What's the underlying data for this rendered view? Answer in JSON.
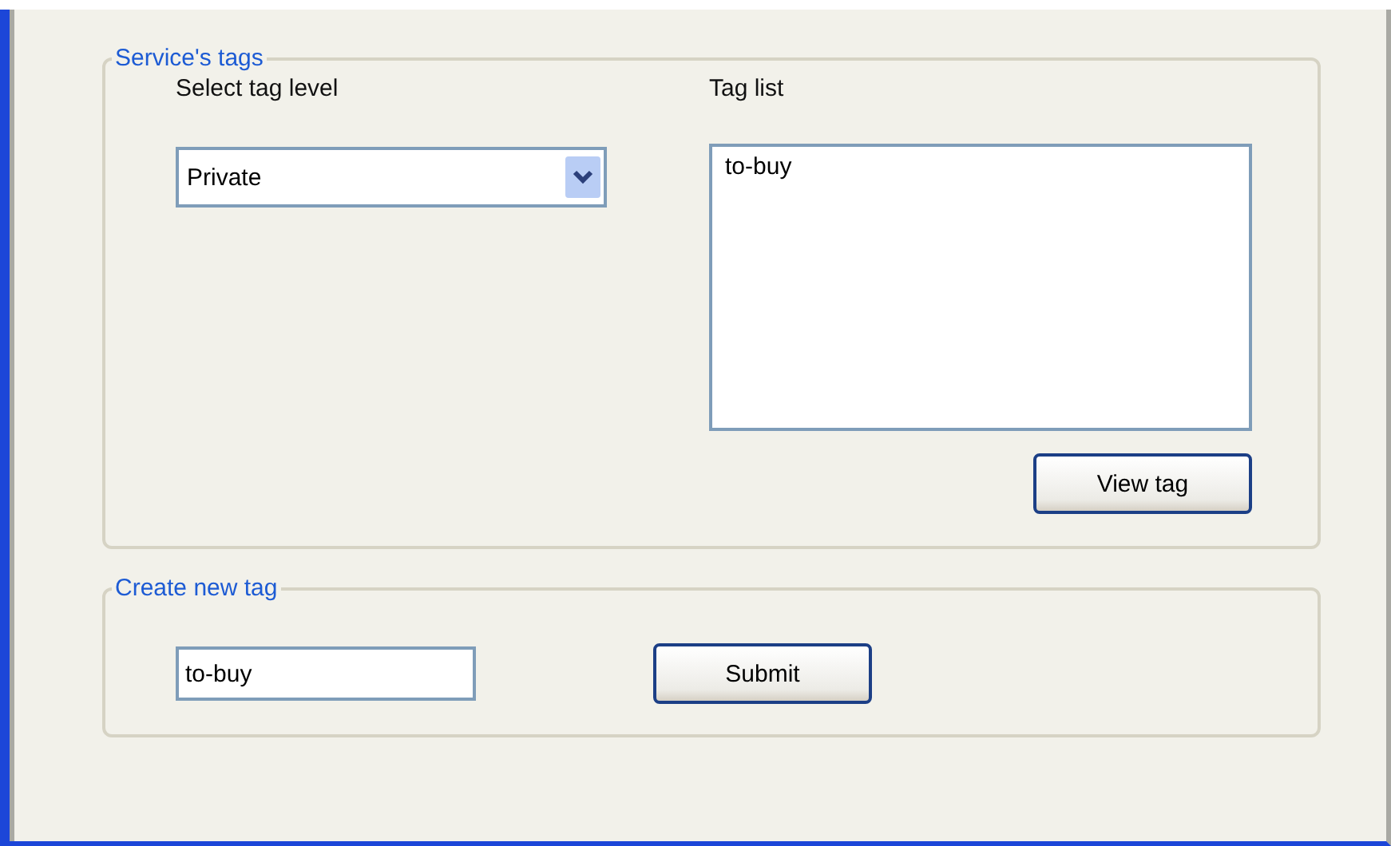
{
  "service_tags": {
    "title": "Service's tags",
    "level_label": "Select tag level",
    "level_select": {
      "value": "Private"
    },
    "tag_list_label": "Tag list",
    "tag_list": [
      {
        "label": "to-buy",
        "selected": false
      }
    ],
    "view_button": "View tag"
  },
  "create_tag": {
    "title": "Create new tag",
    "input": {
      "value": "to-buy"
    },
    "submit_button": "Submit"
  }
}
